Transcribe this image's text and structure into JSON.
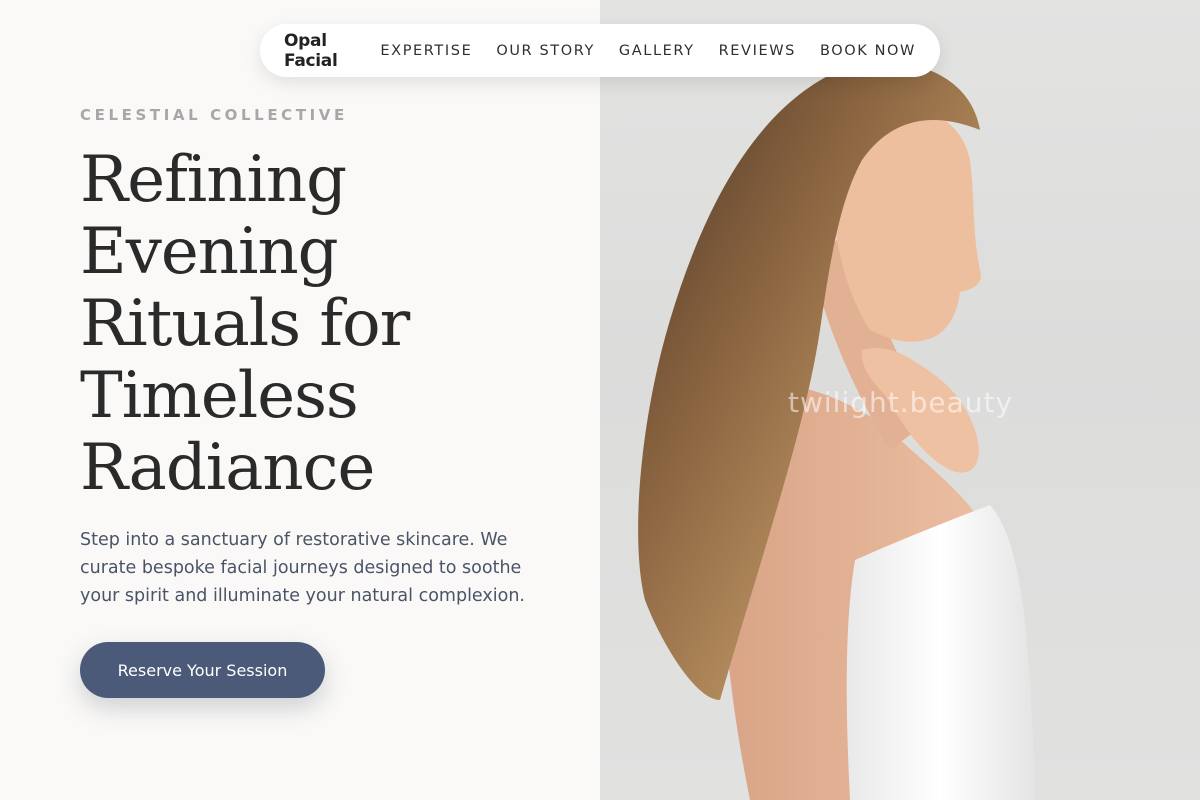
{
  "nav": {
    "brand": "Opal Facial",
    "links": [
      "EXPERTISE",
      "OUR STORY",
      "GALLERY",
      "REVIEWS",
      "BOOK NOW"
    ]
  },
  "hero": {
    "eyebrow": "CELESTIAL COLLECTIVE",
    "headline_lines": [
      "Refining",
      "Evening",
      "Rituals for",
      "Timeless",
      "Radiance"
    ],
    "subtext": "Step into a sanctuary of restorative skincare. We curate bespoke facial journeys designed to soothe your spirit and illuminate your natural complexion.",
    "cta_label": "Reserve Your Session"
  },
  "photo": {
    "watermark": "twilight.beauty",
    "description_icon": "woman-profile-photo"
  },
  "colors": {
    "background": "#faf9f7",
    "cta": "#4a5a78",
    "eyebrow": "#a7a7a9",
    "subtext": "#4a5468"
  }
}
